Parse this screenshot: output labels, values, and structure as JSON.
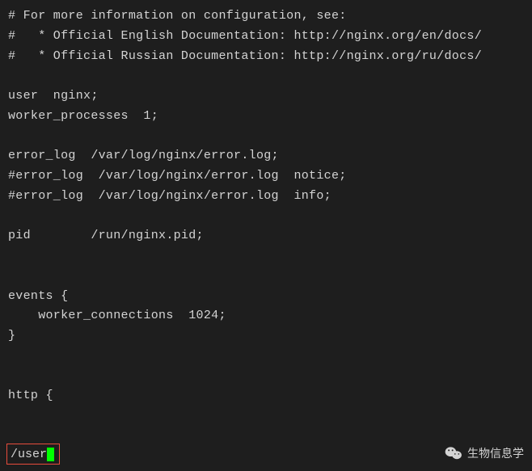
{
  "code": {
    "line1": "# For more information on configuration, see:",
    "line2": "#   * Official English Documentation: http://nginx.org/en/docs/",
    "line3": "#   * Official Russian Documentation: http://nginx.org/ru/docs/",
    "line4": "",
    "line5": "user  nginx;",
    "line6": "worker_processes  1;",
    "line7": "",
    "line8": "error_log  /var/log/nginx/error.log;",
    "line9": "#error_log  /var/log/nginx/error.log  notice;",
    "line10": "#error_log  /var/log/nginx/error.log  info;",
    "line11": "",
    "line12": "pid        /run/nginx.pid;",
    "line13": "",
    "line14": "",
    "line15": "events {",
    "line16": "    worker_connections  1024;",
    "line17": "}",
    "line18": "",
    "line19": "",
    "line20": "http {"
  },
  "search": {
    "prefix": "/",
    "query": "user"
  },
  "watermark": {
    "text": "生物信息学"
  }
}
